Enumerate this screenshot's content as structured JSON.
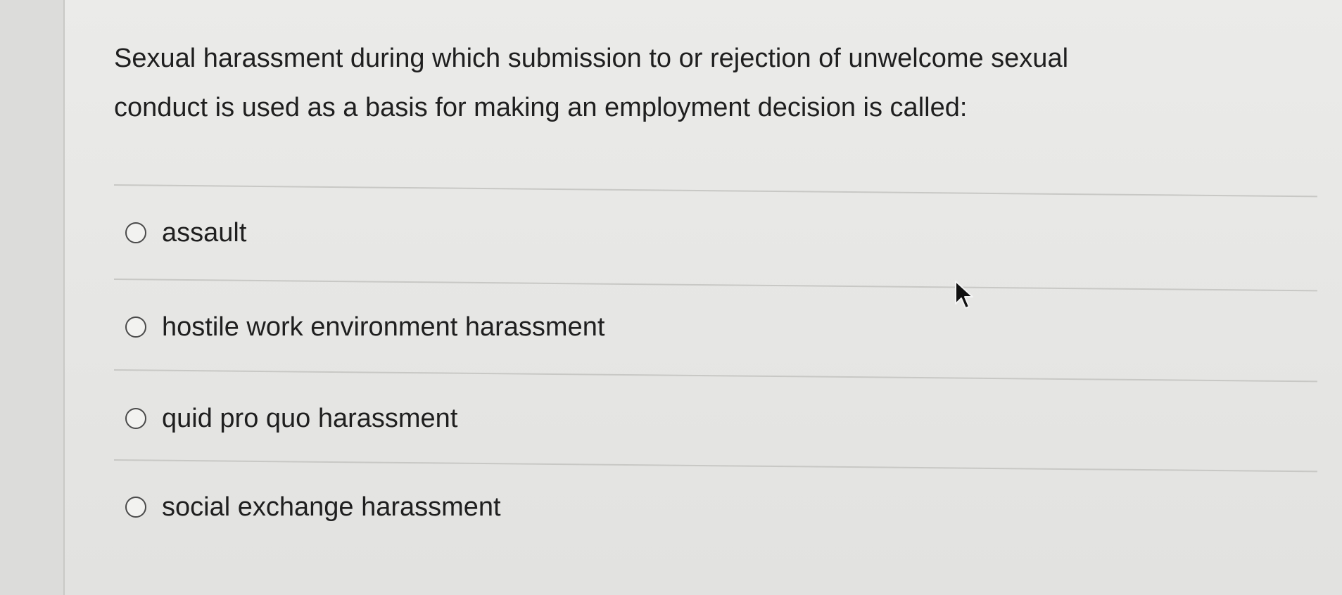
{
  "question": {
    "text_line1": "Sexual harassment during which submission to or rejection of unwelcome sexual",
    "text_line2": "conduct is used as a basis for making an employment decision is called:"
  },
  "options": [
    {
      "label": "assault",
      "selected": false
    },
    {
      "label": "hostile work environment harassment",
      "selected": false
    },
    {
      "label": "quid pro quo harassment",
      "selected": false
    },
    {
      "label": "social exchange harassment",
      "selected": false
    }
  ],
  "icons": {
    "radio": "radio-circle-icon",
    "pointer": "mouse-pointer-icon"
  },
  "colors": {
    "text": "#1f1f1f",
    "background": "#e6e6e4",
    "divider": "#c8c8c5"
  }
}
